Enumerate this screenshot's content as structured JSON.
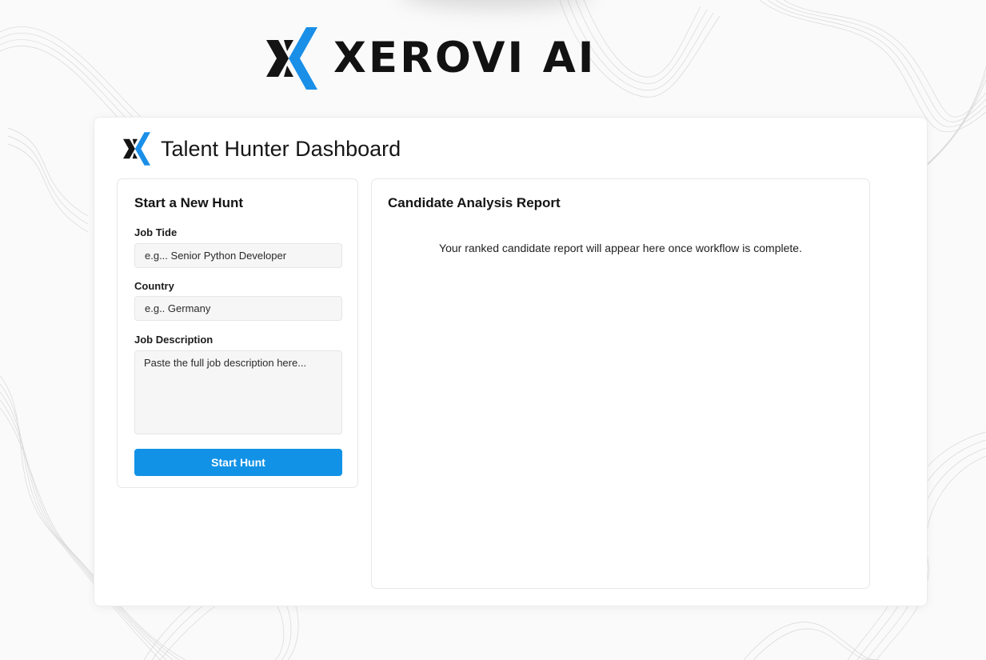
{
  "brand": {
    "name": "XEROVI AI",
    "logo_icon": "xerovi-x-logo-icon",
    "accent_color": "#1a8fe8"
  },
  "dashboard": {
    "title": "Talent Hunter Dashboard"
  },
  "hunt_form": {
    "title": "Start a New Hunt",
    "job_title": {
      "label": "Job Tide",
      "placeholder": "e.g... Senior Python Developer"
    },
    "country": {
      "label": "Country",
      "placeholder": "e.g.. Germany"
    },
    "job_description": {
      "label": "Job Description",
      "placeholder": "Paste the full job description here..."
    },
    "submit_label": "Start Hunt",
    "button_color": "#1292e6"
  },
  "report": {
    "title": "Candidate Analysis Report",
    "placeholder": "Your ranked candidate report will appear here once workflow is complete."
  }
}
